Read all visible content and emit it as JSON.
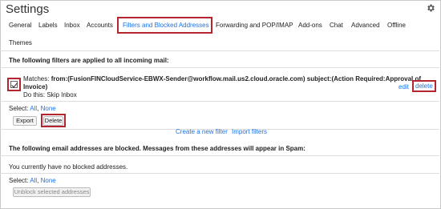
{
  "page": {
    "title": "Settings",
    "settings_icon": "gear-icon"
  },
  "tabs": [
    {
      "label": "General"
    },
    {
      "label": "Labels"
    },
    {
      "label": "Inbox"
    },
    {
      "label": "Accounts"
    },
    {
      "label": "Filters and Blocked Addresses",
      "active": true
    },
    {
      "label": "Forwarding and POP/IMAP"
    },
    {
      "label": "Add-ons"
    },
    {
      "label": "Chat"
    },
    {
      "label": "Advanced"
    },
    {
      "label": "Offline"
    },
    {
      "label": "Themes"
    }
  ],
  "filters": {
    "heading": "The following filters are applied to all incoming mail:",
    "item": {
      "checked": true,
      "matches_label": "Matches:",
      "matches_line1": "from:(FusionFINCloudService-EBWX-Sender@workflow.mail.us2.cloud.oracle.com) subject:(Action Required:Approval of",
      "matches_line2": "Invoice)",
      "action": "Do this: Skip Inbox",
      "edit": "edit",
      "delete": "delete"
    },
    "select_label": "Select:",
    "select_all": "All",
    "select_separator": ",",
    "select_none": "None",
    "export_button": "Export",
    "delete_button": "Delete",
    "create_filter_link": "Create a new filter",
    "import_filters_link": "Import filters"
  },
  "blocked": {
    "heading": "The following email addresses are blocked. Messages from these addresses will appear in Spam:",
    "empty_message": "You currently have no blocked addresses.",
    "select_label": "Select:",
    "select_all": "All",
    "select_separator": ",",
    "select_none": "None",
    "unblock_button": "Unblock selected addresses"
  },
  "colors": {
    "link": "#1a73e8",
    "highlight": "#b3262f"
  }
}
